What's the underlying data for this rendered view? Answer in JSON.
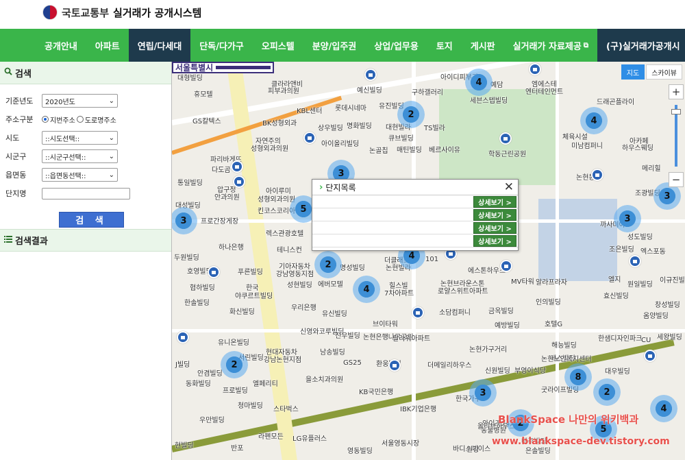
{
  "header": {
    "org": "국토교통부",
    "system": "실거래가 공개시스템"
  },
  "nav": [
    {
      "label": "공개안내",
      "active": false
    },
    {
      "label": "아파트",
      "active": false
    },
    {
      "label": "연립/다세대",
      "active": true
    },
    {
      "label": "단독/다가구",
      "active": false
    },
    {
      "label": "오피스텔",
      "active": false
    },
    {
      "label": "분양/입주권",
      "active": false
    },
    {
      "label": "상업/업무용",
      "active": false
    },
    {
      "label": "토지",
      "active": false
    },
    {
      "label": "게시판",
      "active": false
    },
    {
      "label": "실거래가 자료제공",
      "active": false
    },
    {
      "label": "(구)실거래가공개시",
      "active": false
    }
  ],
  "search_panel": {
    "title": "검색",
    "base_year_label": "기준년도",
    "base_year_value": "2020년도",
    "address_type_label": "주소구분",
    "address_type_options": [
      "지번주소",
      "도로명주소"
    ],
    "address_type_selected": "지번주소",
    "sido_label": "시도",
    "sido_value": "::시도선택::",
    "sigungu_label": "시군구",
    "sigungu_value": "::시군구선택::",
    "eupmyeon_label": "읍면동",
    "eupmyeon_value": "::읍면동선택::",
    "complex_label": "단지명",
    "complex_value": "",
    "search_button": "검 색"
  },
  "results_panel": {
    "title": "검색결과"
  },
  "map": {
    "district": "서울특별시",
    "map_types": [
      "지도",
      "스카이뷰"
    ],
    "selected_type": "지도",
    "zoom_in": "+",
    "zoom_out": "−",
    "labels": [
      "대형빌딩",
      "클라라앤비",
      "피부과의원",
      "휴모텔",
      "GS칼텍스",
      "BK성형외과",
      "KBL센터",
      "롯데시네마",
      "자연주의",
      "성형외과의원",
      "파리바게뜨",
      "다도곰",
      "통일빌딩",
      "압구정",
      "안과의원",
      "아이루미",
      "성형외과의원",
      "킨코스코리아",
      "대성빌딩",
      "프로간장게장",
      "하나은행",
      "렉스관광호텔",
      "테니스컨",
      "두원빌딩",
      "호영빌딩",
      "푸른빌딩",
      "기아자동차",
      "강남영동지점",
      "성현빌딩",
      "협하빌딩",
      "한국",
      "야쿠르트빌딩",
      "한솔빌딩",
      "화신빌딩",
      "우리은행",
      "유니온빌딩",
      "서린빌딩",
      "현대자동차",
      "강남논현지점",
      "J빌딩",
      "안겸빌딩",
      "동화빌딩",
      "엘페리티",
      "프로빌딩",
      "청마빌딩",
      "스타벅스",
      "우만빌딩",
      "라펜모든",
      "LG유플러스",
      "현빌딩",
      "반포",
      "예신빌딩",
      "유진빌딩",
      "구하갤러리",
      "세븐스텝빌딩",
      "엠에스테",
      "엔터테인먼트",
      "드래곤플라이",
      "명화빌딩",
      "대현빌라",
      "TS빌라",
      "상우빌딩",
      "아이올리빌딩",
      "큐브빌딩",
      "논골칩",
      "매틴빌딩",
      "베르사이유",
      "학동근린공원",
      "체육시설",
      "미남컴퍼니",
      "아카페",
      "하우스웨딩",
      "메리힐",
      "논현동",
      "조광빌딩",
      "까사미아",
      "성도빌딩",
      "조은빌딩",
      "엑스포동",
      "명성빌딩",
      "에버모텔",
      "더클래스",
      "논현빌라",
      "101",
      "에스톤하우스",
      "MV타워",
      "알라프라자",
      "엘지",
      "원일빌딩",
      "이규진빌딩",
      "인의빌딩",
      "금옥빌딩",
      "예방빌딩",
      "호텔G",
      "유신빌딩",
      "신영와코루빌딩",
      "진우빌딩",
      "브이타워",
      "논현은행나무공원",
      "랄라워아파트",
      "소담컴퍼니",
      "한샘디자인파크",
      "해능빌딩",
      "에스빌딩",
      "남송빌딩",
      "GS25",
      "환웅빌딩",
      "더메일리하우스",
      "논현가구거리",
      "신원빌딩",
      "부영이식당",
      "논현노인복지센터",
      "굿라이프빌딩",
      "을소치과의원",
      "KB국민은행",
      "한국가구",
      "와이즈24시",
      "동물병원",
      "IBK기업은행",
      "서울영동시장",
      "영동빌딩",
      "바디스페이스",
      "원강",
      "은솔빌딩",
      "올리브하우스",
      "대주빌딩",
      "대우빌딩",
      "세왕빌딩",
      "CU",
      "창성빌딩",
      "옴양빌딩",
      "효신빌딩",
      "힐스빌",
      "7차아파트",
      "논현브라운스톤",
      "로얄스위트아파트",
      "아이디피부과",
      "예담"
    ],
    "clusters": [
      4,
      2,
      4,
      3,
      5,
      3,
      2,
      4,
      4,
      3,
      3,
      2,
      8,
      2,
      3,
      4,
      5,
      2
    ]
  },
  "popup": {
    "title": "단지목록",
    "close": "✕",
    "rows": [
      {
        "name": "",
        "button": "상세보기 >"
      },
      {
        "name": "",
        "button": "상세보기 >"
      },
      {
        "name": "",
        "button": "상세보기 >"
      },
      {
        "name": "",
        "button": "상세보기 >"
      }
    ]
  },
  "watermark": {
    "line1": "BlankSpace 나만의 위키백과",
    "line2": "www.blankspace-dev.tistory.com"
  },
  "colors": {
    "nav_green": "#3ab54a",
    "nav_active": "#1e3a4c",
    "search_button": "#3e6fd1",
    "detail_button": "#3c8a3b",
    "district_border": "#3b2e7a",
    "watermark": "#e8514c"
  }
}
